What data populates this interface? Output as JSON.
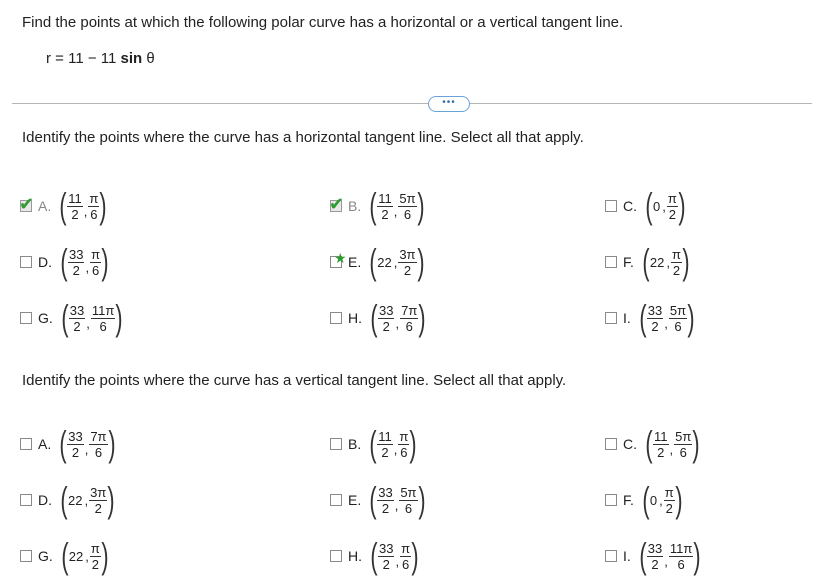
{
  "question": {
    "instruction": "Find the points at which the following polar curve has a horizontal or a vertical tangent line.",
    "equation_prefix": "r = 11 − 11 ",
    "equation_sin": "sin",
    "equation_theta": "θ"
  },
  "more_button_label": "•••",
  "horizontal": {
    "prompt": "Identify the points where the curve has a horizontal tangent line. Select all that apply.",
    "options": [
      {
        "letter": "A.",
        "r_num": "11",
        "r_den": "2",
        "t_num": "π",
        "t_den": "6",
        "state": "checked-correct"
      },
      {
        "letter": "B.",
        "r_num": "11",
        "r_den": "2",
        "t_num": "5π",
        "t_den": "6",
        "state": "checked-correct"
      },
      {
        "letter": "C.",
        "r_plain": "0",
        "t_num": "π",
        "t_den": "2",
        "state": "unchecked"
      },
      {
        "letter": "D.",
        "r_num": "33",
        "r_den": "2",
        "t_num": "π",
        "t_den": "6",
        "state": "unchecked"
      },
      {
        "letter": "E.",
        "r_plain": "22",
        "t_num": "3π",
        "t_den": "2",
        "state": "starred"
      },
      {
        "letter": "F.",
        "r_plain": "22",
        "t_num": "π",
        "t_den": "2",
        "state": "unchecked"
      },
      {
        "letter": "G.",
        "r_num": "33",
        "r_den": "2",
        "t_num": "11π",
        "t_den": "6",
        "state": "unchecked"
      },
      {
        "letter": "H.",
        "r_num": "33",
        "r_den": "2",
        "t_num": "7π",
        "t_den": "6",
        "state": "unchecked"
      },
      {
        "letter": "I.",
        "r_num": "33",
        "r_den": "2",
        "t_num": "5π",
        "t_den": "6",
        "state": "unchecked"
      }
    ]
  },
  "vertical": {
    "prompt": "Identify the points where the curve has a vertical tangent line. Select all that apply.",
    "options": [
      {
        "letter": "A.",
        "r_num": "33",
        "r_den": "2",
        "t_num": "7π",
        "t_den": "6",
        "state": "unchecked"
      },
      {
        "letter": "B.",
        "r_num": "11",
        "r_den": "2",
        "t_num": "π",
        "t_den": "6",
        "state": "unchecked"
      },
      {
        "letter": "C.",
        "r_num": "11",
        "r_den": "2",
        "t_num": "5π",
        "t_den": "6",
        "state": "unchecked"
      },
      {
        "letter": "D.",
        "r_plain": "22",
        "t_num": "3π",
        "t_den": "2",
        "state": "unchecked"
      },
      {
        "letter": "E.",
        "r_num": "33",
        "r_den": "2",
        "t_num": "5π",
        "t_den": "6",
        "state": "unchecked"
      },
      {
        "letter": "F.",
        "r_plain": "0",
        "t_num": "π",
        "t_den": "2",
        "state": "unchecked"
      },
      {
        "letter": "G.",
        "r_plain": "22",
        "t_num": "π",
        "t_den": "2",
        "state": "unchecked"
      },
      {
        "letter": "H.",
        "r_num": "33",
        "r_den": "2",
        "t_num": "π",
        "t_den": "6",
        "state": "unchecked"
      },
      {
        "letter": "I.",
        "r_num": "33",
        "r_den": "2",
        "t_num": "11π",
        "t_den": "6",
        "state": "unchecked"
      }
    ]
  },
  "colors": {
    "check_green": "#2e9b2e",
    "link_blue": "#3a6fa8"
  }
}
